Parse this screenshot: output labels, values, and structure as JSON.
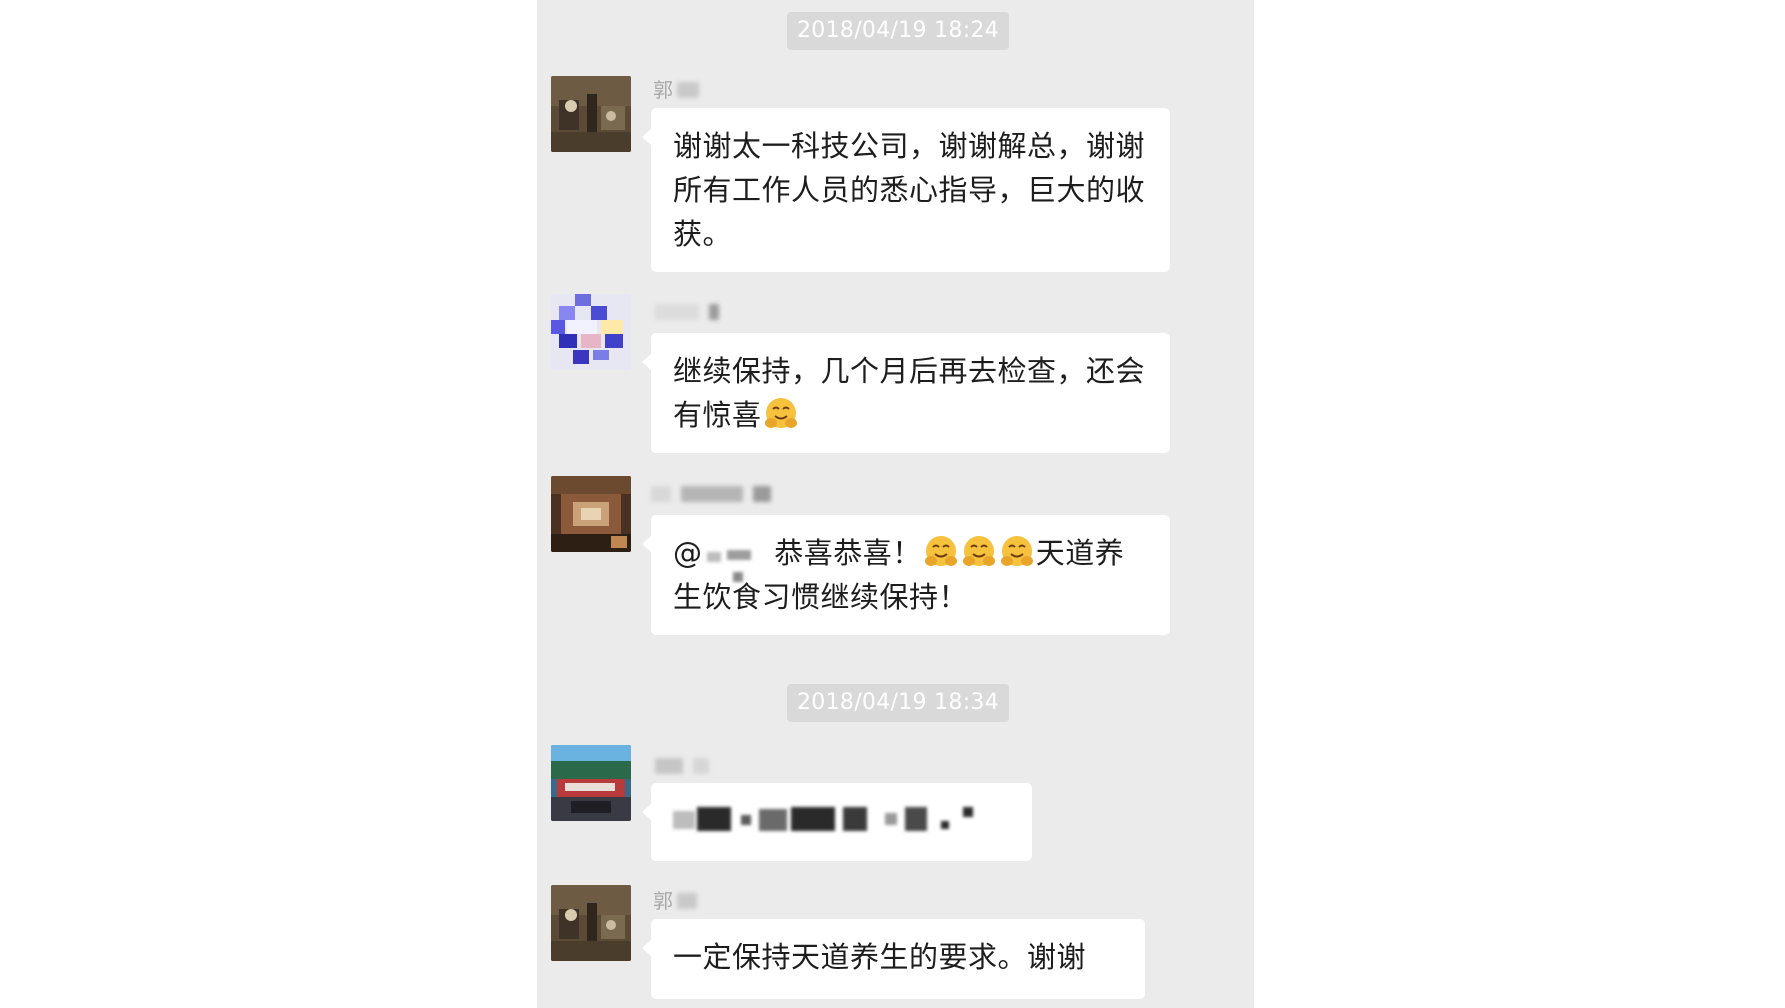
{
  "chat": {
    "timestamps": [
      "2018/04/19 18:24",
      "2018/04/19 18:34"
    ],
    "messages": [
      {
        "sender_visible": "郭",
        "text": "谢谢太一科技公司，谢谢解总，谢谢所有工作人员的悉心指导，巨大的收获。"
      },
      {
        "sender_visible": "",
        "text": "继续保持，几个月后再去检查，还会有惊喜"
      },
      {
        "sender_visible": "",
        "mention_prefix": "@",
        "text_before_emoji": "恭喜恭喜！",
        "text_after_emoji": "天道养生饮食习惯继续保持！"
      },
      {
        "sender_visible": "",
        "text": ""
      },
      {
        "sender_visible": "郭",
        "text": "一定保持天道养生的要求。谢谢"
      }
    ],
    "emoji": "hug-face-emoji"
  },
  "colors": {
    "chat_bg": "#ebebeb",
    "bubble_bg": "#ffffff",
    "timestamp_bg": "#d9d9d9",
    "timestamp_text": "#ffffff",
    "name_text": "#a8a8a8",
    "message_text": "#1d1d1d"
  }
}
